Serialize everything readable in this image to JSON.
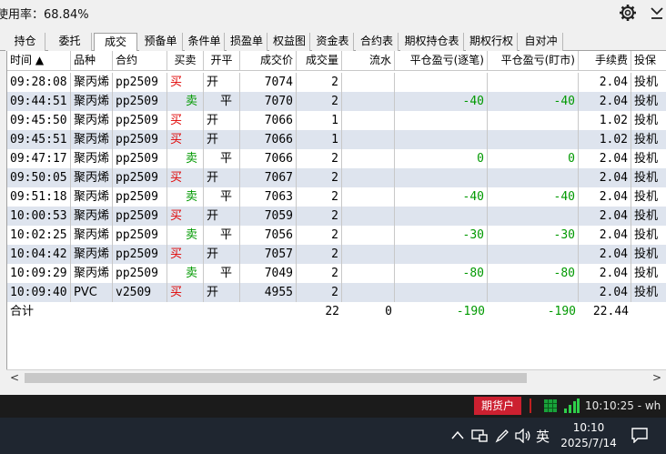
{
  "header": {
    "usage_label": "使用率：",
    "usage_value": "68.84%"
  },
  "tabs": [
    "持仓",
    "委托",
    "成交",
    "预备单",
    "条件单",
    "损盈单",
    "权益图",
    "资金表",
    "合约表",
    "期权持仓表",
    "期权行权",
    "自对冲"
  ],
  "active_tab": "成交",
  "columns": [
    "时间 ▲",
    "品种",
    "合约",
    "买卖",
    "开平",
    "成交价",
    "成交量",
    "流水",
    "平仓盈亏(逐笔)",
    "平仓盈亏(盯市)",
    "手续费",
    "投保"
  ],
  "rows": [
    {
      "time": "09:28:08",
      "product": "聚丙烯",
      "contract": "pp2509",
      "side": "买",
      "oc": "开",
      "price": "7074",
      "qty": "2",
      "flow": "",
      "pnl_trade": "",
      "pnl_mark": "",
      "fee": "2.04",
      "hedge": "投机"
    },
    {
      "time": "09:44:51",
      "product": "聚丙烯",
      "contract": "pp2509",
      "side": "卖",
      "oc": "平",
      "price": "7070",
      "qty": "2",
      "flow": "",
      "pnl_trade": "-40",
      "pnl_mark": "-40",
      "fee": "2.04",
      "hedge": "投机"
    },
    {
      "time": "09:45:50",
      "product": "聚丙烯",
      "contract": "pp2509",
      "side": "买",
      "oc": "开",
      "price": "7066",
      "qty": "1",
      "flow": "",
      "pnl_trade": "",
      "pnl_mark": "",
      "fee": "1.02",
      "hedge": "投机"
    },
    {
      "time": "09:45:51",
      "product": "聚丙烯",
      "contract": "pp2509",
      "side": "买",
      "oc": "开",
      "price": "7066",
      "qty": "1",
      "flow": "",
      "pnl_trade": "",
      "pnl_mark": "",
      "fee": "1.02",
      "hedge": "投机"
    },
    {
      "time": "09:47:17",
      "product": "聚丙烯",
      "contract": "pp2509",
      "side": "卖",
      "oc": "平",
      "price": "7066",
      "qty": "2",
      "flow": "",
      "pnl_trade": "0",
      "pnl_mark": "0",
      "fee": "2.04",
      "hedge": "投机"
    },
    {
      "time": "09:50:05",
      "product": "聚丙烯",
      "contract": "pp2509",
      "side": "买",
      "oc": "开",
      "price": "7067",
      "qty": "2",
      "flow": "",
      "pnl_trade": "",
      "pnl_mark": "",
      "fee": "2.04",
      "hedge": "投机"
    },
    {
      "time": "09:51:18",
      "product": "聚丙烯",
      "contract": "pp2509",
      "side": "卖",
      "oc": "平",
      "price": "7063",
      "qty": "2",
      "flow": "",
      "pnl_trade": "-40",
      "pnl_mark": "-40",
      "fee": "2.04",
      "hedge": "投机"
    },
    {
      "time": "10:00:53",
      "product": "聚丙烯",
      "contract": "pp2509",
      "side": "买",
      "oc": "开",
      "price": "7059",
      "qty": "2",
      "flow": "",
      "pnl_trade": "",
      "pnl_mark": "",
      "fee": "2.04",
      "hedge": "投机"
    },
    {
      "time": "10:02:25",
      "product": "聚丙烯",
      "contract": "pp2509",
      "side": "卖",
      "oc": "平",
      "price": "7056",
      "qty": "2",
      "flow": "",
      "pnl_trade": "-30",
      "pnl_mark": "-30",
      "fee": "2.04",
      "hedge": "投机"
    },
    {
      "time": "10:04:42",
      "product": "聚丙烯",
      "contract": "pp2509",
      "side": "买",
      "oc": "开",
      "price": "7057",
      "qty": "2",
      "flow": "",
      "pnl_trade": "",
      "pnl_mark": "",
      "fee": "2.04",
      "hedge": "投机"
    },
    {
      "time": "10:09:29",
      "product": "聚丙烯",
      "contract": "pp2509",
      "side": "卖",
      "oc": "平",
      "price": "7049",
      "qty": "2",
      "flow": "",
      "pnl_trade": "-80",
      "pnl_mark": "-80",
      "fee": "2.04",
      "hedge": "投机"
    },
    {
      "time": "10:09:40",
      "product": "PVC",
      "contract": "v2509",
      "side": "买",
      "oc": "开",
      "price": "4955",
      "qty": "2",
      "flow": "",
      "pnl_trade": "",
      "pnl_mark": "",
      "fee": "2.04",
      "hedge": "投机"
    }
  ],
  "total": {
    "label": "合计",
    "qty": "22",
    "flow": "0",
    "pnl_trade": "-190",
    "pnl_mark": "-190",
    "fee": "22.44"
  },
  "statusbar": {
    "account_type": "期货户",
    "time_text": "10:10:25 - wh"
  },
  "taskbar": {
    "ime": "英",
    "clock_time": "10:10",
    "clock_date": "2025/7/14"
  },
  "colors": {
    "buy": "#e00000",
    "sell": "#009900",
    "alt_row": "#dee4ee",
    "account_badge": "#cc2030"
  }
}
